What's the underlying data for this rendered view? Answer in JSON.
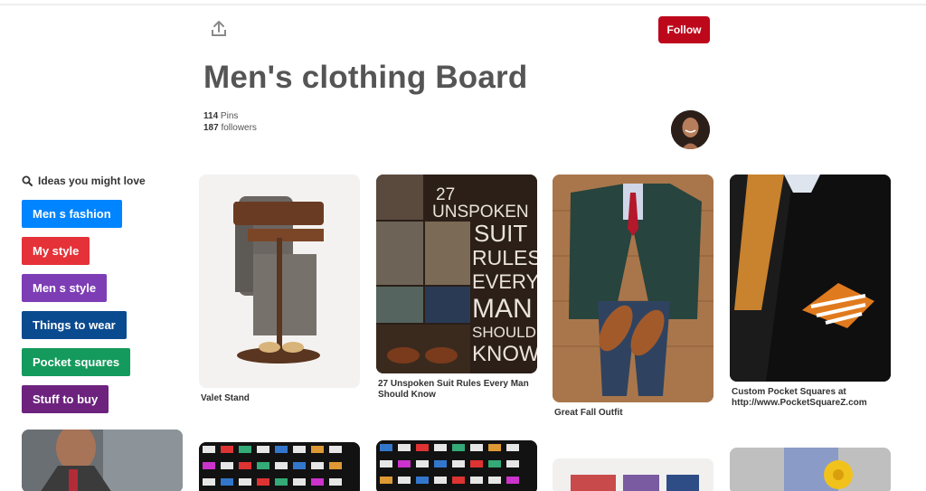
{
  "header": {
    "share_icon": "share-icon",
    "follow_label": "Follow",
    "follow_color": "#bd081c"
  },
  "board": {
    "title": "Men's clothing Board",
    "pins_count": "114",
    "pins_label": "Pins",
    "followers_count": "187",
    "followers_label": "followers"
  },
  "ideas": {
    "title": "Ideas you might love",
    "tags": [
      {
        "label": "Men s fashion",
        "color": "#0084ff"
      },
      {
        "label": "My style",
        "color": "#e53238"
      },
      {
        "label": "Men s style",
        "color": "#7d3db5"
      },
      {
        "label": "Things to wear",
        "color": "#0a4a8f"
      },
      {
        "label": "Pocket squares",
        "color": "#149a5c"
      },
      {
        "label": "Stuff to buy",
        "color": "#6d237e"
      }
    ]
  },
  "pins": [
    {
      "caption": "Valet Stand"
    },
    {
      "caption": "27 Unspoken Suit Rules Every Man Should Know",
      "image_text": [
        "27",
        "UNSPOKEN",
        "SUIT",
        "RULES",
        "EVERY",
        "MAN",
        "SHOULD",
        "KNOW"
      ]
    },
    {
      "caption": "Great Fall Outfit"
    },
    {
      "caption": "Custom Pocket Squares at http://www.PocketSquareZ.com"
    }
  ]
}
